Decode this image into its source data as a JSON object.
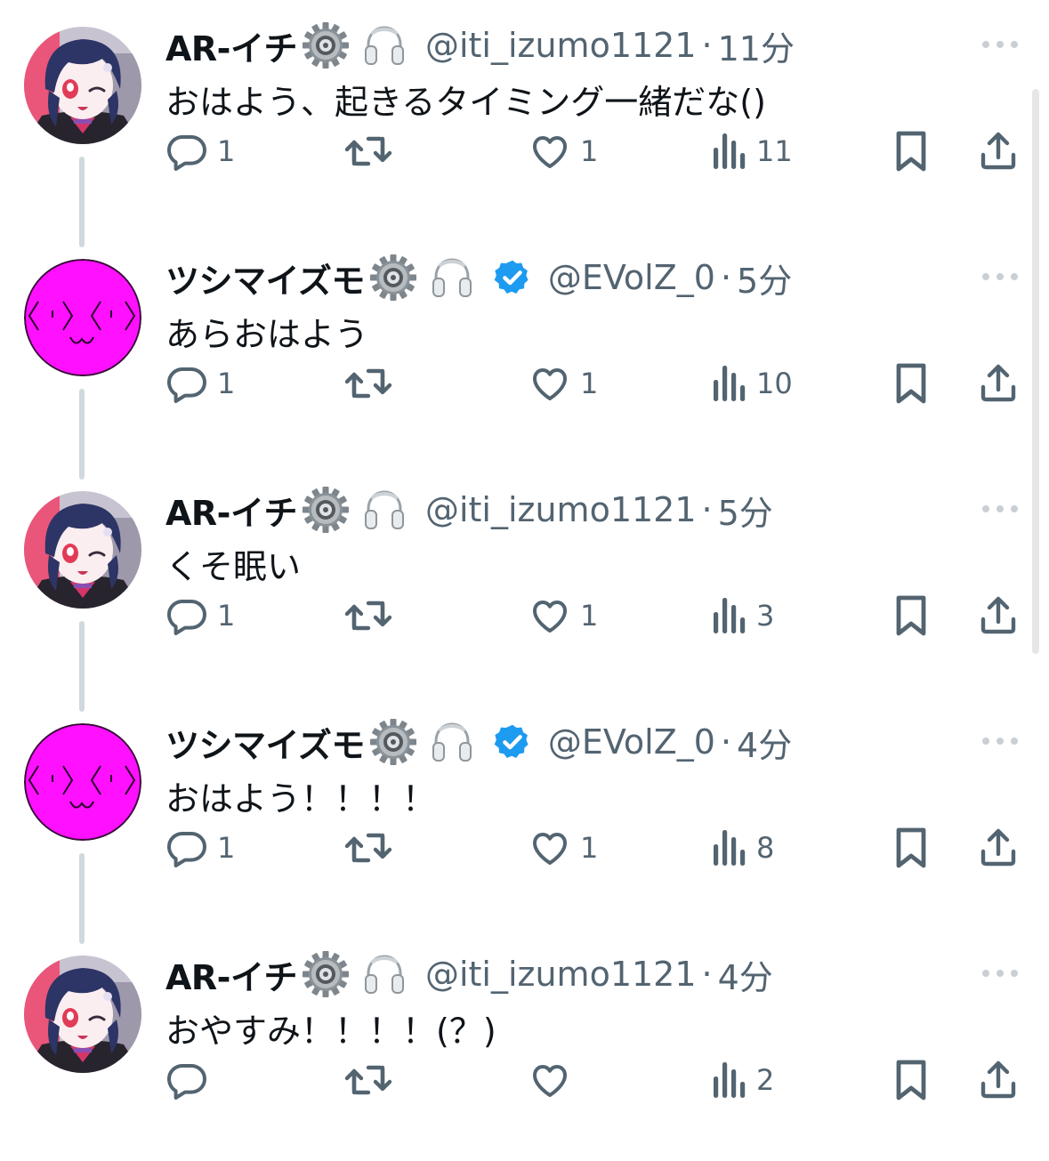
{
  "colors": {
    "text": "#0f1419",
    "secondary": "#536471",
    "verified": "#1d9bf0",
    "thread_line": "#cfd9de",
    "magenta_avatar": "#ff10ff"
  },
  "tweets": [
    {
      "name": "AR-イチ",
      "name_emojis": [
        "gear-emoji",
        "headphones-emoji"
      ],
      "verified": false,
      "handle": "@iti_izumo1121",
      "separator": "·",
      "time": "11分",
      "text": "おはよう、起きるタイミング一緒だな()",
      "avatar": "anime-avatar",
      "replies": "1",
      "retweets": "",
      "likes": "1",
      "views": "11"
    },
    {
      "name": "ツシマイズモ",
      "name_emojis": [
        "gear-emoji",
        "headphones-emoji"
      ],
      "verified": true,
      "handle": "@EVolZ_0",
      "separator": "·",
      "time": "5分",
      "text": "あらおはよう",
      "avatar": "magenta-face-avatar",
      "replies": "1",
      "retweets": "",
      "likes": "1",
      "views": "10"
    },
    {
      "name": "AR-イチ",
      "name_emojis": [
        "gear-emoji",
        "headphones-emoji"
      ],
      "verified": false,
      "handle": "@iti_izumo1121",
      "separator": "·",
      "time": "5分",
      "text": "くそ眠い",
      "avatar": "anime-avatar",
      "replies": "1",
      "retweets": "",
      "likes": "1",
      "views": "3"
    },
    {
      "name": "ツシマイズモ",
      "name_emojis": [
        "gear-emoji",
        "headphones-emoji"
      ],
      "verified": true,
      "handle": "@EVolZ_0",
      "separator": "·",
      "time": "4分",
      "text": "おはよう！！！！",
      "avatar": "magenta-face-avatar",
      "replies": "1",
      "retweets": "",
      "likes": "1",
      "views": "8"
    },
    {
      "name": "AR-イチ",
      "name_emojis": [
        "gear-emoji",
        "headphones-emoji"
      ],
      "verified": false,
      "handle": "@iti_izumo1121",
      "separator": "·",
      "time": "4分",
      "text": "おやすみ！！！！(？)",
      "avatar": "anime-avatar",
      "replies": "",
      "retweets": "",
      "likes": "",
      "views": "2"
    }
  ]
}
